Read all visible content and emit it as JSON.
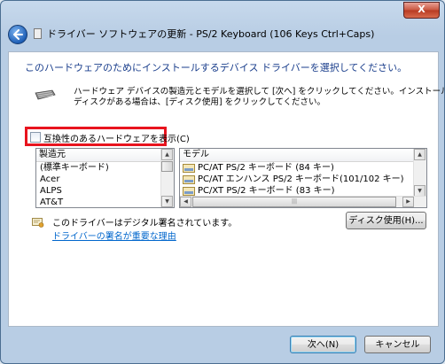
{
  "window": {
    "title": "ドライバー ソフトウェアの更新 - PS/2 Keyboard (106 Keys Ctrl+Caps)",
    "close_glyph": "X"
  },
  "heading": "このハードウェアのためにインストールするデバイス ドライバーを選択してください。",
  "description": {
    "line1": "ハードウェア デバイスの製造元とモデルを選択して [次へ] をクリックしてください。インストールするドライバーの",
    "line2": "ディスクがある場合は、[ディスク使用] をクリックしてください。"
  },
  "compatible_checkbox": {
    "label": "互換性のあるハードウェアを表示(C)",
    "checked": false
  },
  "manufacturer_list": {
    "header": "製造元",
    "items": [
      "(標準キーボード)",
      "Acer",
      "ALPS",
      "AT&T"
    ]
  },
  "model_list": {
    "header": "モデル",
    "items": [
      "PC/AT PS/2 キーボード (84 キー)",
      "PC/AT エンハンス PS/2 キーボード(101/102 キー)",
      "PC/XT PS/2 キーボード (83 キー)"
    ]
  },
  "signature": {
    "text": "このドライバーはデジタル署名されています。",
    "link": "ドライバーの署名が重要な理由"
  },
  "buttons": {
    "have_disk": "ディスク使用(H)...",
    "next": "次へ(N)",
    "cancel": "キャンセル"
  },
  "colors": {
    "heading": "#1a3e8c",
    "link": "#0066cc",
    "highlight_box": "#e8141e"
  }
}
